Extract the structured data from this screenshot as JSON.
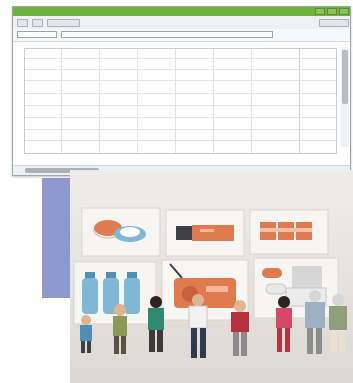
{
  "window": {
    "titlebar_color": "#6fb23d",
    "controls": [
      "minimize",
      "maximize",
      "close"
    ]
  },
  "toolbar": {
    "buttons": [
      "",
      "",
      ""
    ]
  },
  "address": {
    "left_field": "",
    "main_field": ""
  },
  "grid": {
    "rows": 9,
    "columns": 7
  },
  "photo": {
    "description_icons": [
      "medicine-tape-icon",
      "flashlight-icon",
      "battery-pack-icon",
      "water-bottles-icon",
      "radio-icon",
      "pills-toilet-paper-icon"
    ],
    "figurine_count": 9
  },
  "colors": {
    "blue_panel": "#8f97cf",
    "photo_background": "#e9e6e1"
  }
}
